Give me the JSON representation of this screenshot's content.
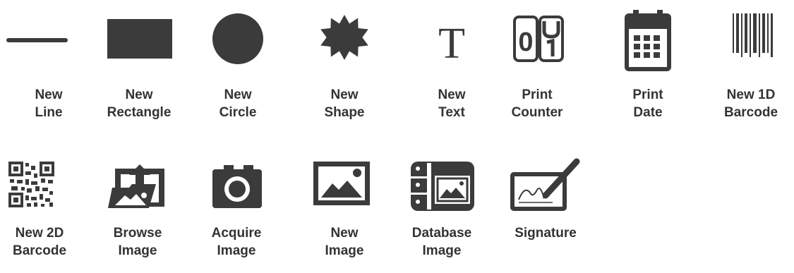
{
  "colors": {
    "icon": "#3b3b3b",
    "text": "#333333",
    "background": "#ffffff"
  },
  "tools": [
    {
      "id": "new-line",
      "icon": "line-icon",
      "label": [
        "New",
        "Line"
      ]
    },
    {
      "id": "new-rectangle",
      "icon": "rectangle-icon",
      "label": [
        "New",
        "Rectangle"
      ]
    },
    {
      "id": "new-circle",
      "icon": "circle-icon",
      "label": [
        "New",
        "Circle"
      ]
    },
    {
      "id": "new-shape",
      "icon": "star-shape-icon",
      "label": [
        "New",
        "Shape"
      ]
    },
    {
      "id": "new-text",
      "icon": "text-t-icon",
      "label": [
        "New",
        "Text"
      ]
    },
    {
      "id": "print-counter",
      "icon": "counter-icon",
      "label": [
        "Print",
        "Counter"
      ]
    },
    {
      "id": "print-date",
      "icon": "calendar-icon",
      "label": [
        "Print",
        "Date"
      ]
    },
    {
      "id": "new-1d-barcode",
      "icon": "barcode-icon",
      "label": [
        "New 1D",
        "Barcode"
      ]
    },
    {
      "id": "new-2d-barcode",
      "icon": "qr-code-icon",
      "label": [
        "New 2D",
        "Barcode"
      ]
    },
    {
      "id": "browse-image",
      "icon": "folder-image-upload-icon",
      "label": [
        "Browse",
        "Image"
      ]
    },
    {
      "id": "acquire-image",
      "icon": "camera-icon",
      "label": [
        "Acquire",
        "Image"
      ]
    },
    {
      "id": "new-image",
      "icon": "picture-icon",
      "label": [
        "New",
        "Image"
      ]
    },
    {
      "id": "database-image",
      "icon": "database-image-icon",
      "label": [
        "Database",
        "Image"
      ]
    },
    {
      "id": "signature",
      "icon": "signature-pad-icon",
      "label": [
        "Signature"
      ]
    }
  ],
  "counter_digits": "0",
  "text_glyph": "T"
}
